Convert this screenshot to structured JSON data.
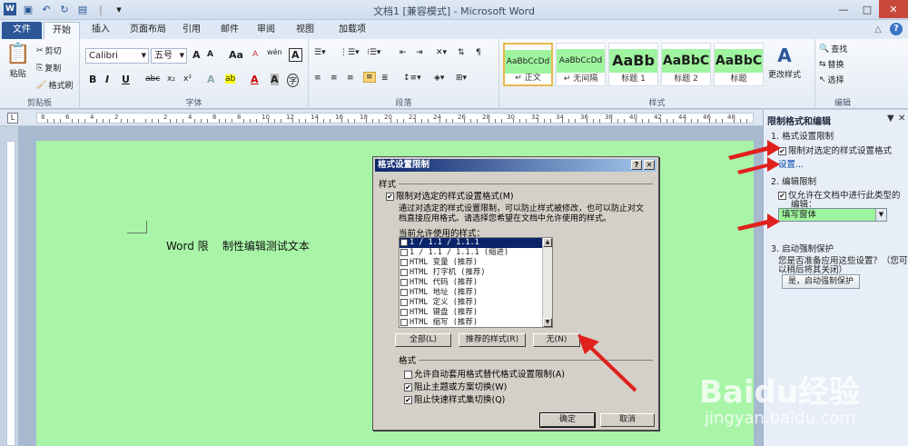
{
  "window": {
    "title": "文档1 [兼容模式] - Microsoft Word"
  },
  "qat": {
    "separator_glyph": "|",
    "dropdown_glyph": "▾"
  },
  "window_controls": {
    "minimize": "—",
    "maximize": "□",
    "close": "✕"
  },
  "tabs": [
    "文件",
    "开始",
    "插入",
    "页面布局",
    "引用",
    "邮件",
    "审阅",
    "视图",
    "加载项"
  ],
  "help_icons": {
    "collapse": "△",
    "help": "?"
  },
  "ribbon": {
    "clipboard": {
      "paste": "粘贴",
      "cut": "剪切",
      "copy": "复制",
      "format_painter": "格式刷",
      "label": "剪贴板"
    },
    "font": {
      "name": "Calibri",
      "size": "五号",
      "label": "字体",
      "size_up": "A",
      "size_down": "A",
      "case": "Aa",
      "clear": "A",
      "wen": "wén",
      "char_border": "A",
      "bold": "B",
      "italic": "I",
      "underline": "U",
      "strike": "abc",
      "sub": "x₂",
      "sup": "x²",
      "effects": "A",
      "highlight": "ab",
      "color": "A",
      "shade": "A",
      "enclose": "字"
    },
    "paragraph": {
      "label": "段落"
    },
    "styles": {
      "label": "样式",
      "items": [
        {
          "sample": "AaBbCcDd",
          "name": "↵ 正文"
        },
        {
          "sample": "AaBbCcDd",
          "name": "↵ 无间隔"
        },
        {
          "sample": "AaBb",
          "name": "标题 1"
        },
        {
          "sample": "AaBbC",
          "name": "标题 2"
        },
        {
          "sample": "AaBbC",
          "name": "标题"
        }
      ],
      "change_styles": "更改样式"
    },
    "editing": {
      "label": "编辑",
      "find": "查找",
      "replace": "替换",
      "select": "选择"
    }
  },
  "document": {
    "text": "Word 限    制性编辑测试文本"
  },
  "ruler": {
    "numbers": [
      "8",
      "6",
      "4",
      "2",
      "",
      "2",
      "4",
      "6",
      "8",
      "10",
      "12",
      "14",
      "16",
      "18",
      "20",
      "22",
      "24",
      "26",
      "28",
      "30",
      "32",
      "34",
      "36",
      "38",
      "40",
      "42",
      "44",
      "46",
      "48"
    ]
  },
  "pane": {
    "title": "限制格式和编辑",
    "close_glyph": "✕",
    "dropdown_glyph": "▼",
    "section1": "1. 格式设置限制",
    "limit_format_label": "限制对选定的样式设置格式",
    "settings_link": "设置...",
    "section2": "2. 编辑限制",
    "allow_edit_label": "仅允许在文档中进行此类型的",
    "allow_edit_label2": "编辑：",
    "edit_type": "填写窗体",
    "section3": "3. 启动强制保护",
    "apply_question": "您是否准备应用这些设置？（您可",
    "apply_question2": "以稍后将其关闭）",
    "enforce_button": "是，启动强制保护"
  },
  "dialog": {
    "title": "格式设置限制",
    "help_glyph": "?",
    "close_glyph": "✕",
    "scroll_up": "▲",
    "scroll_down": "▼",
    "styles_group": "样式",
    "limit_label": "限制对选定的样式设置格式(M)",
    "desc1": "通过对选定的样式设置限制，可以防止样式被修改，也可以防止对文",
    "desc2": "档直接应用格式。请选择您希望在文档中允许使用的样式。",
    "allowed_label": "当前允许使用的样式：",
    "list": [
      {
        "text": "1 / 1.1 / 1.1.1",
        "checked": false,
        "selected": true
      },
      {
        "text": "1 / 1.1 / 1.1.1 (缩进)",
        "checked": false,
        "selected": false
      },
      {
        "text": "HTML 变量 (推荐)",
        "checked": false,
        "selected": false
      },
      {
        "text": "HTML 打字机 (推荐)",
        "checked": false,
        "selected": false
      },
      {
        "text": "HTML 代码 (推荐)",
        "checked": false,
        "selected": false
      },
      {
        "text": "HTML 地址 (推荐)",
        "checked": false,
        "selected": false
      },
      {
        "text": "HTML 定义 (推荐)",
        "checked": false,
        "selected": false
      },
      {
        "text": "HTML 键盘 (推荐)",
        "checked": false,
        "selected": false
      },
      {
        "text": "HTML 缩写 (推荐)",
        "checked": false,
        "selected": false
      }
    ],
    "btn_all": "全部(L)",
    "btn_recommended": "推荐的样式(R)",
    "btn_none": "无(N)",
    "format_group": "格式",
    "opt1": "允许自动套用格式替代格式设置限制(A)",
    "opt2": "阻止主题或方案切换(W)",
    "opt3": "阻止快速样式集切换(Q)",
    "opt1_checked": false,
    "opt2_checked": true,
    "opt3_checked": true,
    "ok": "确定",
    "cancel": "取消"
  },
  "watermark": {
    "main": "Baidu经验",
    "sub": "jingyan.baidu.com"
  }
}
